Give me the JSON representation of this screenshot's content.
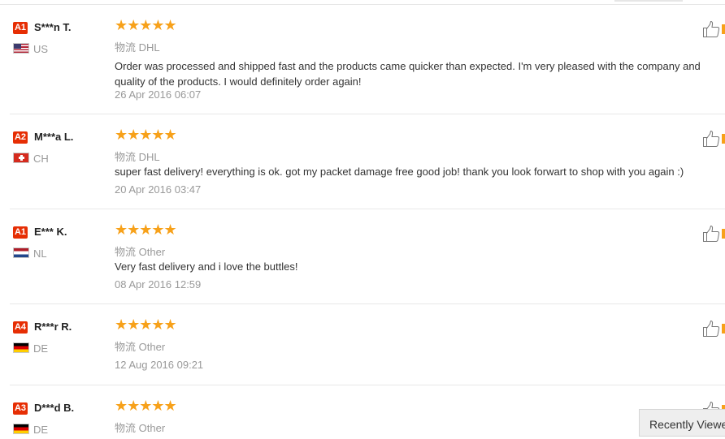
{
  "reviews": [
    {
      "badge": "A1",
      "name": "S***n T.",
      "country": "US",
      "flag": "us-flag",
      "stars": "★★★★★",
      "rating": 5,
      "logistics_label": "物流",
      "logistics": "DHL",
      "feedback": "Order was processed and shipped fast and the products came quicker than expected. I'm very pleased with the company and quality of the products. I would definitely order again!",
      "date": "26 Apr 2016 06:07"
    },
    {
      "badge": "A2",
      "name": "M***a L.",
      "country": "CH",
      "flag": "ch-flag",
      "stars": "★★★★★",
      "rating": 5,
      "logistics_label": "物流",
      "logistics": "DHL",
      "feedback": "super fast delivery! everything is ok. got my packet damage free good job! thank you look forwart to shop with you again :)",
      "date": "20 Apr 2016 03:47"
    },
    {
      "badge": "A1",
      "name": "E*** K.",
      "country": "NL",
      "flag": "nl-flag",
      "stars": "★★★★★",
      "rating": 5,
      "logistics_label": "物流",
      "logistics": "Other",
      "feedback": "Very fast delivery and i love the buttles!",
      "date": "08 Apr 2016 12:59"
    },
    {
      "badge": "A4",
      "name": "R***r R.",
      "country": "DE",
      "flag": "de-flag",
      "stars": "★★★★★",
      "rating": 5,
      "logistics_label": "物流",
      "logistics": "Other",
      "feedback": "",
      "date": "12 Aug 2016 09:21"
    },
    {
      "badge": "A3",
      "name": "D***d B.",
      "country": "DE",
      "flag": "de-flag",
      "stars": "★★★★★",
      "rating": 5,
      "logistics_label": "物流",
      "logistics": "Other",
      "feedback": "",
      "date": ""
    }
  ],
  "recently_viewed": "Recently Viewed",
  "icons": {
    "helpful": "thumbs-up-icon"
  },
  "colors": {
    "badge": "#e62e04",
    "stars": "#f7a11a",
    "muted": "#999999"
  }
}
